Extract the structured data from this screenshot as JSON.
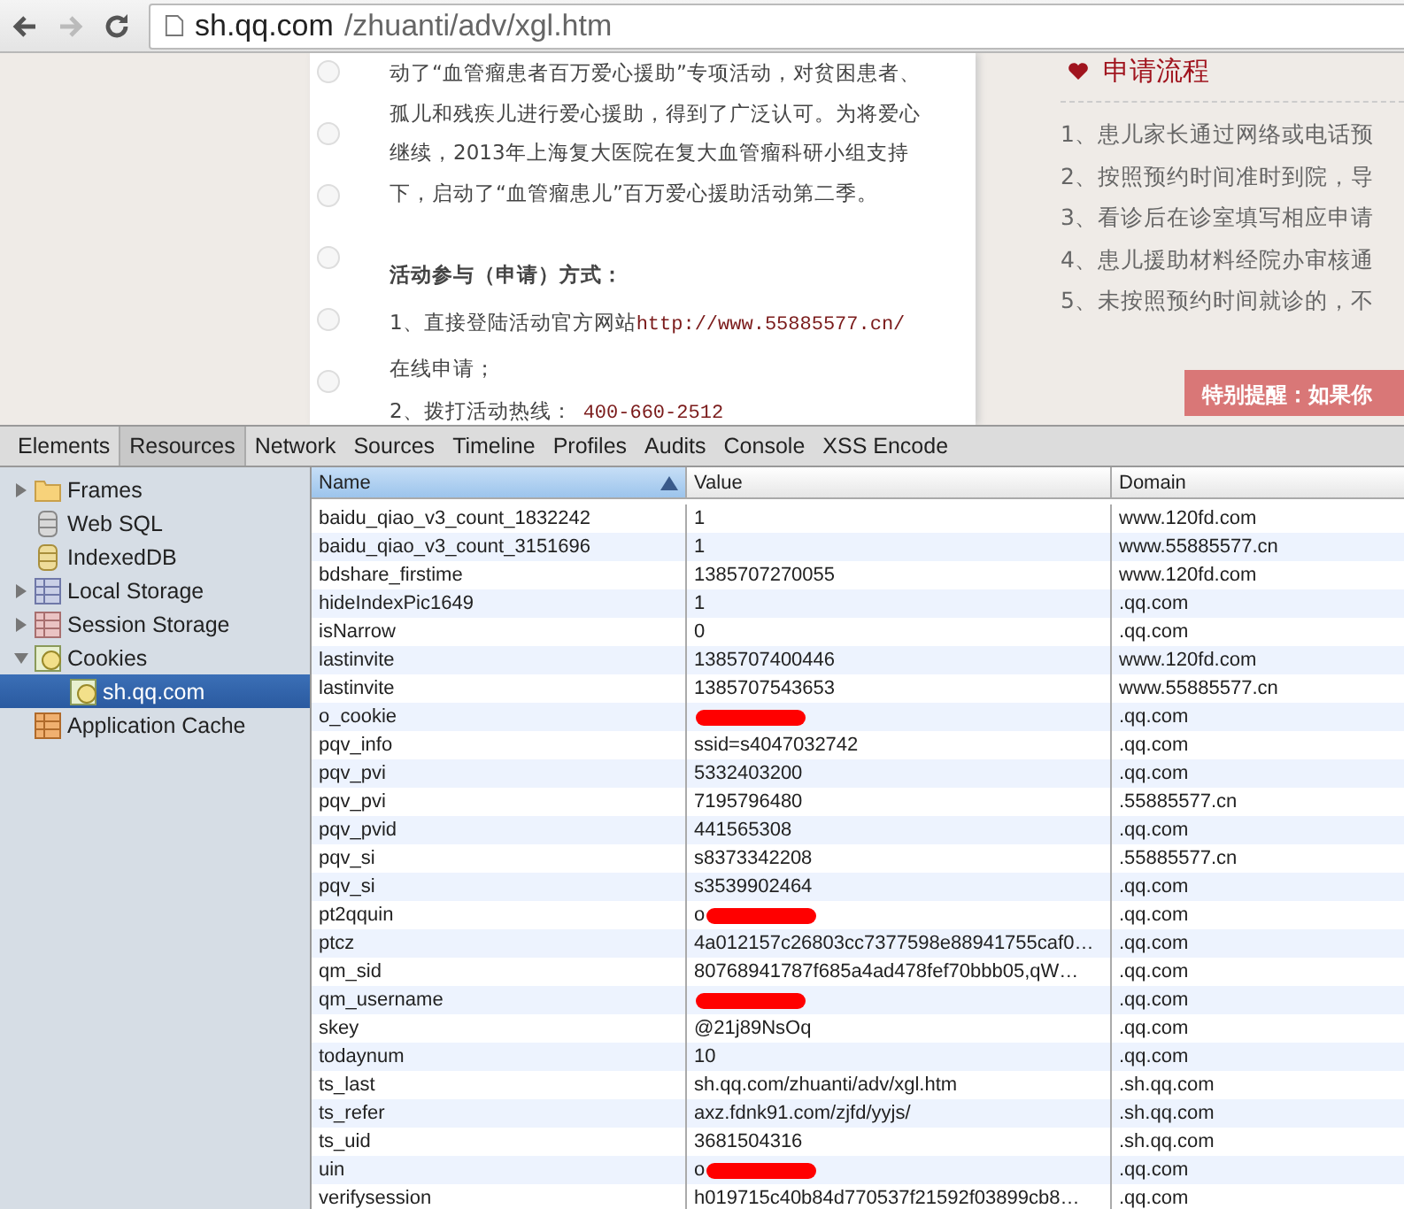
{
  "browser": {
    "url_host": "sh.qq.com",
    "url_path": "/zhuanti/adv/xgl.htm"
  },
  "page": {
    "article": [
      {
        "kind": "paragraph",
        "text": "动了“血管瘤患者百万爱心援助”专项活动，对贫困患者、孤儿和残疾儿进行爱心援助，得到了广泛认可。为将爱心继续，2013年上海复大医院在复大血管瘤科研小组支持下，启动了“血管瘤患儿”百万爱心援助活动第二季。"
      },
      {
        "kind": "heading",
        "text": "活动参与（申请）方式："
      },
      {
        "kind": "item",
        "text": "1、直接登陆活动官方网站",
        "link": "http://www.55885577.cn/",
        "after": "在线申请；"
      },
      {
        "kind": "item",
        "text": "2、拨打活动热线：",
        "phone": "400-660-2512"
      }
    ],
    "side": {
      "title": "申请流程",
      "steps": [
        "1、患儿家长通过网络或电话预",
        "2、按照预约时间准时到院，导",
        "3、看诊后在诊室填写相应申请",
        "4、患儿援助材料经院办审核通",
        "5、未按照预约时间就诊的，不"
      ],
      "notice": "特别提醒：如果你"
    }
  },
  "devtools": {
    "tabs": [
      {
        "label": "Elements",
        "selected": false
      },
      {
        "label": "Resources",
        "selected": true
      },
      {
        "label": "Network",
        "selected": false
      },
      {
        "label": "Sources",
        "selected": false
      },
      {
        "label": "Timeline",
        "selected": false
      },
      {
        "label": "Profiles",
        "selected": false
      },
      {
        "label": "Audits",
        "selected": false
      },
      {
        "label": "Console",
        "selected": false
      },
      {
        "label": "XSS Encode",
        "selected": false
      }
    ],
    "sidebar": {
      "items": [
        {
          "label": "Frames",
          "expanded": false,
          "selected": false
        },
        {
          "label": "Web SQL",
          "selected": false
        },
        {
          "label": "IndexedDB",
          "selected": false
        },
        {
          "label": "Local Storage",
          "expanded": false,
          "selected": false
        },
        {
          "label": "Session Storage",
          "expanded": false,
          "selected": false
        },
        {
          "label": "Cookies",
          "expanded": true,
          "selected": false,
          "children": [
            {
              "label": "sh.qq.com",
              "selected": true
            }
          ]
        },
        {
          "label": "Application Cache",
          "selected": false
        }
      ]
    },
    "table": {
      "columns": [
        {
          "label": "Name",
          "sorted": true
        },
        {
          "label": "Value",
          "sorted": false
        },
        {
          "label": "Domain",
          "sorted": false
        }
      ],
      "rows": [
        {
          "name": "baidu_qiao_v3_count_1832242",
          "value": "1",
          "domain": "www.120fd.com"
        },
        {
          "name": "baidu_qiao_v3_count_3151696",
          "value": "1",
          "domain": "www.55885577.cn"
        },
        {
          "name": "bdshare_firstime",
          "value": "1385707270055",
          "domain": "www.120fd.com"
        },
        {
          "name": "hideIndexPic1649",
          "value": "1",
          "domain": ".qq.com"
        },
        {
          "name": "isNarrow",
          "value": "0",
          "domain": ".qq.com"
        },
        {
          "name": "lastinvite",
          "value": "1385707400446",
          "domain": "www.120fd.com"
        },
        {
          "name": "lastinvite",
          "value": "1385707543653",
          "domain": "www.55885577.cn"
        },
        {
          "name": "o_cookie",
          "redacted": true,
          "domain": ".qq.com"
        },
        {
          "name": "pqv_info",
          "value": "ssid=s4047032742",
          "domain": ".qq.com"
        },
        {
          "name": "pqv_pvi",
          "value": "5332403200",
          "domain": ".qq.com"
        },
        {
          "name": "pqv_pvi",
          "value": "7195796480",
          "domain": ".55885577.cn"
        },
        {
          "name": "pqv_pvid",
          "value": "441565308",
          "domain": ".qq.com"
        },
        {
          "name": "pqv_si",
          "value": "s8373342208",
          "domain": ".55885577.cn"
        },
        {
          "name": "pqv_si",
          "value": "s3539902464",
          "domain": ".qq.com"
        },
        {
          "name": "pt2qquin",
          "value": "o",
          "redacted": true,
          "domain": ".qq.com"
        },
        {
          "name": "ptcz",
          "value": "4a012157c26803cc7377598e88941755caf0…",
          "domain": ".qq.com"
        },
        {
          "name": "qm_sid",
          "value": "80768941787f685a4ad478fef70bbb05,qW…",
          "domain": ".qq.com"
        },
        {
          "name": "qm_username",
          "redacted": true,
          "domain": ".qq.com"
        },
        {
          "name": "skey",
          "value": "@21j89NsOq",
          "domain": ".qq.com"
        },
        {
          "name": "todaynum",
          "value": "10",
          "domain": ".qq.com"
        },
        {
          "name": "ts_last",
          "value": "sh.qq.com/zhuanti/adv/xgl.htm",
          "domain": ".sh.qq.com"
        },
        {
          "name": "ts_refer",
          "value": "axz.fdnk91.com/zjfd/yyjs/",
          "domain": ".sh.qq.com"
        },
        {
          "name": "ts_uid",
          "value": "3681504316",
          "domain": ".sh.qq.com"
        },
        {
          "name": "uin",
          "value": "o",
          "redacted": true,
          "domain": ".qq.com"
        },
        {
          "name": "verifysession",
          "value": "h019715c40b84d770537f21592f03899cb8…",
          "domain": ".qq.com"
        }
      ]
    }
  }
}
